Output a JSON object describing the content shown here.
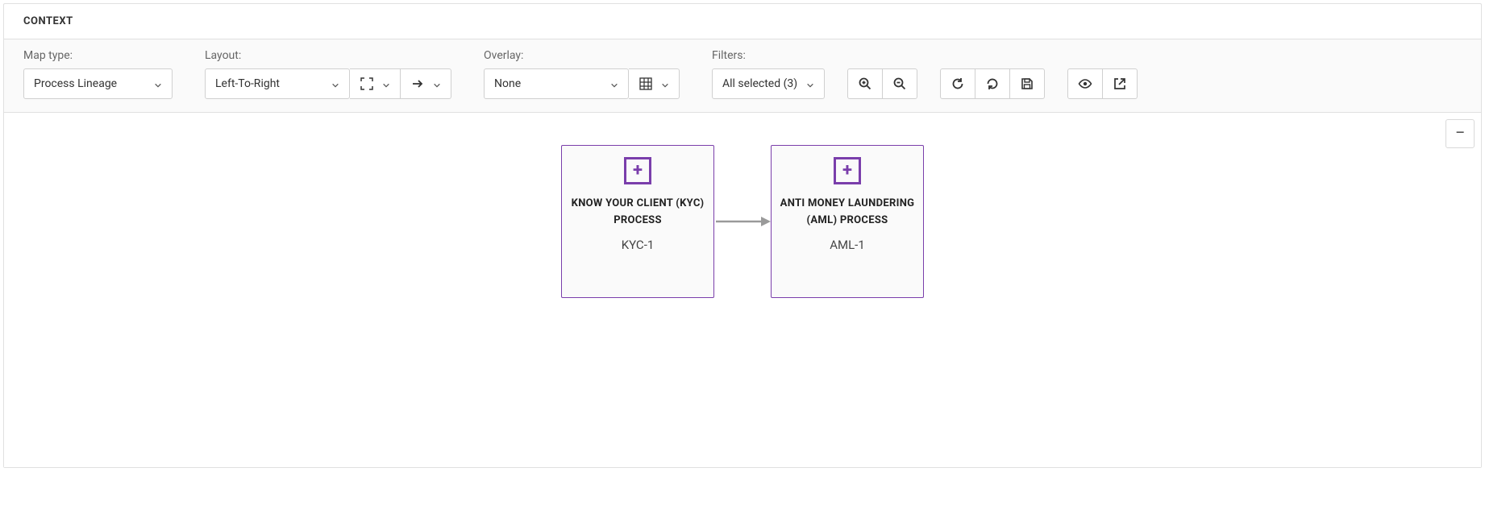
{
  "panel": {
    "title": "CONTEXT"
  },
  "toolbar": {
    "mapType": {
      "label": "Map type:",
      "value": "Process Lineage"
    },
    "layout": {
      "label": "Layout:",
      "value": "Left-To-Right"
    },
    "overlay": {
      "label": "Overlay:",
      "value": "None"
    },
    "filters": {
      "label": "Filters:",
      "value": "All selected (3)"
    }
  },
  "diagram": {
    "nodes": [
      {
        "title": "KNOW YOUR CLIENT (KYC) PROCESS",
        "code": "KYC-1"
      },
      {
        "title": "ANTI MONEY LAUNDERING (AML) PROCESS",
        "code": "AML-1"
      }
    ]
  }
}
